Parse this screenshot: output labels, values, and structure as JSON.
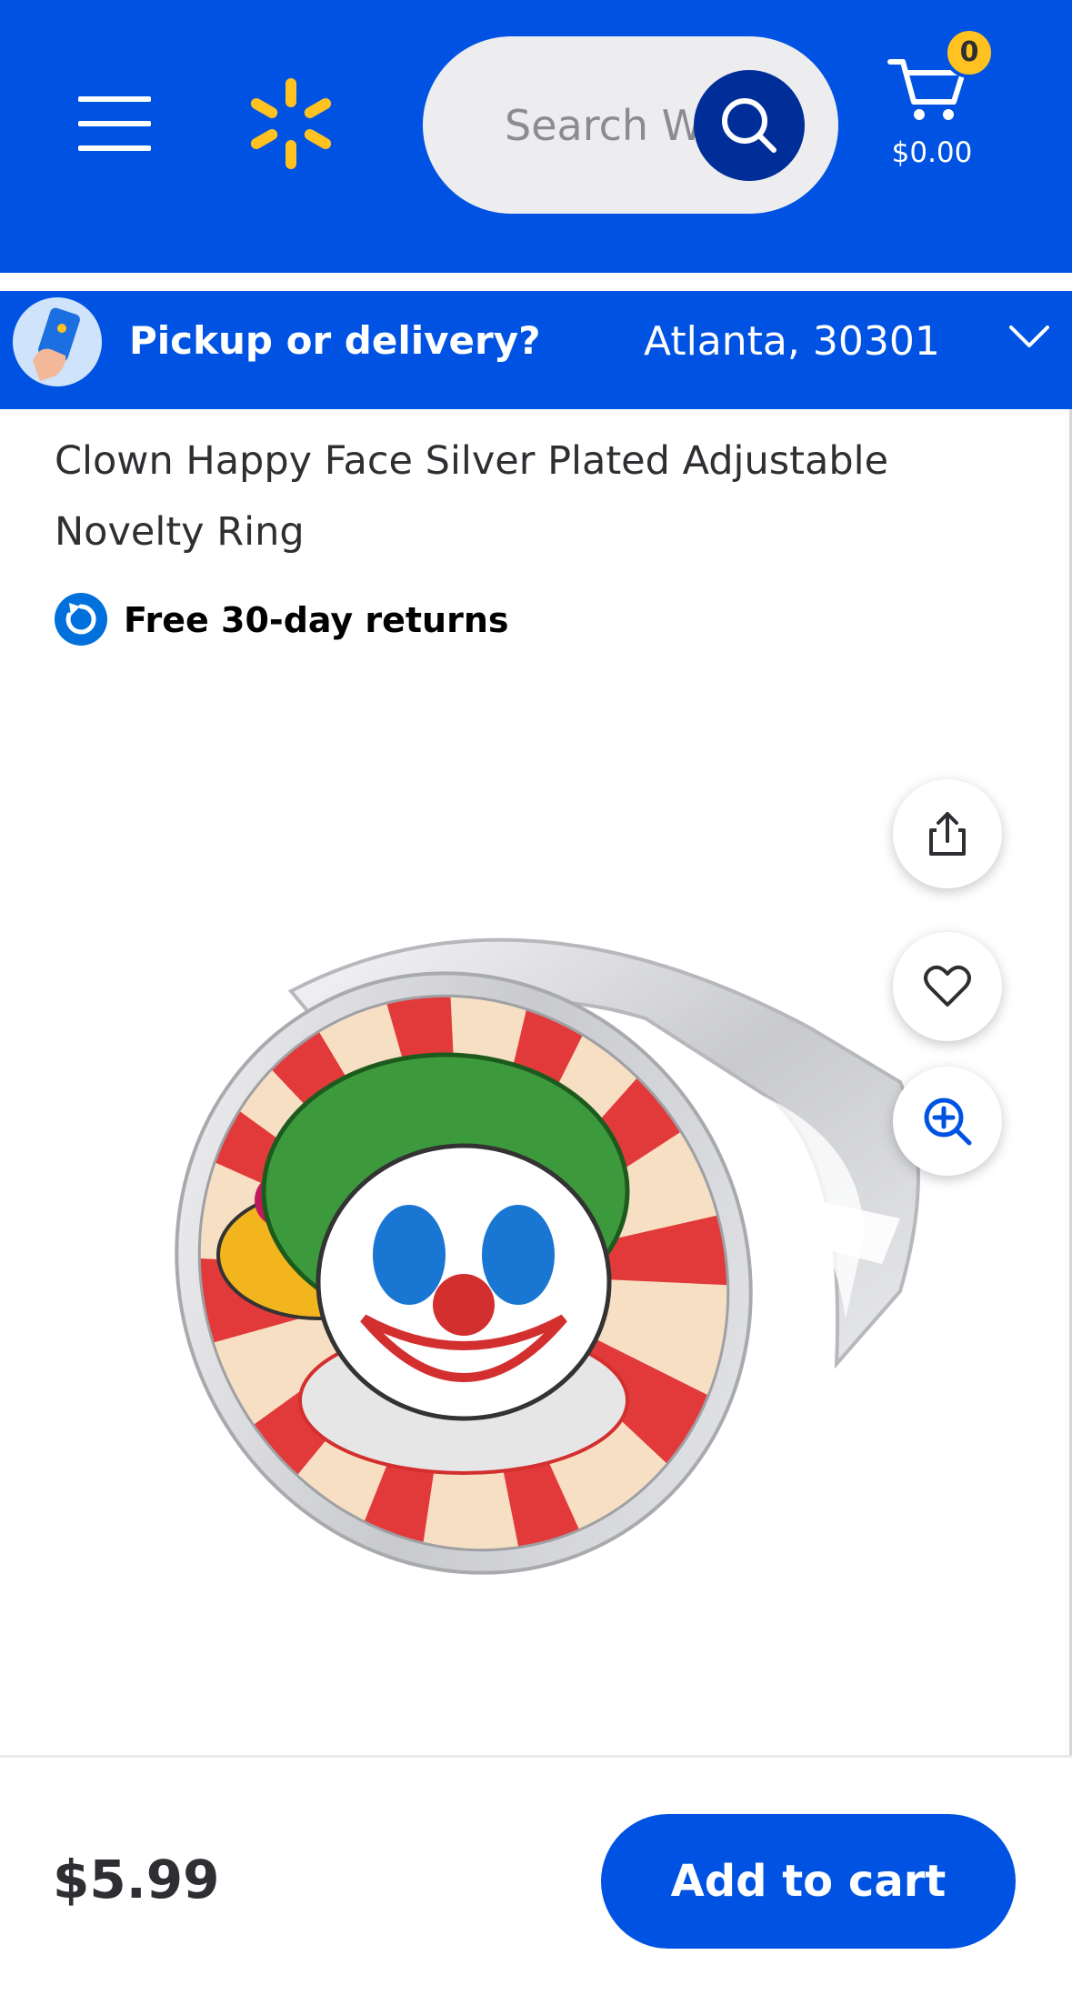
{
  "header": {
    "search_placeholder": "Search Walmart",
    "cart_count": "0",
    "cart_total": "$0.00"
  },
  "location": {
    "title": "Pickup or delivery?",
    "city": "Atlanta, 30301"
  },
  "product": {
    "title": "Clown Happy Face Silver Plated Adjustable Novelty Ring",
    "returns_label": "Free 30-day returns",
    "price": "$5.99",
    "add_to_cart_label": "Add to cart"
  },
  "colors": {
    "brand_blue": "#0053e2",
    "spark_yellow": "#ffc220",
    "search_button": "#002e99"
  },
  "icons": [
    "menu-icon",
    "walmart-spark-logo",
    "search-icon",
    "cart-icon",
    "pickup-delivery-icon",
    "chevron-down-icon",
    "returns-icon",
    "share-icon",
    "heart-icon",
    "zoom-in-icon"
  ]
}
